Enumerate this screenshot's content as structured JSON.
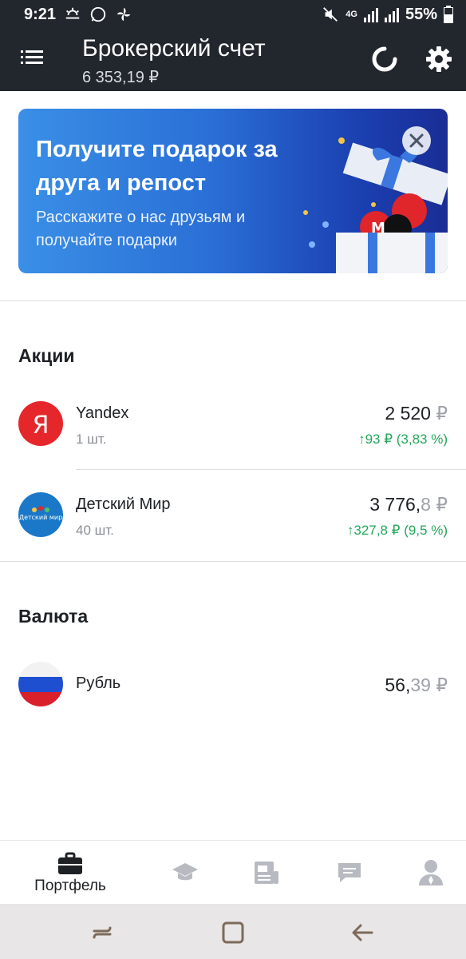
{
  "statusbar": {
    "time": "9:21",
    "network": "4G",
    "battery_pct": "55%"
  },
  "header": {
    "title": "Брокерский счет",
    "balance": "6 353,19 ₽"
  },
  "banner": {
    "title": "Получите подарок за друга и репост",
    "text": "Расскажите о нас друзьям и получайте подарки"
  },
  "stocks": {
    "section_title": "Акции",
    "items": [
      {
        "name": "Yandex",
        "qty": "1 шт.",
        "price_main": "2 520",
        "price_frac": "",
        "currency": "₽",
        "change": "↑93 ₽ (3,83 %)"
      },
      {
        "name": "Детский Мир",
        "qty": "40 шт.",
        "price_main": "3 776,",
        "price_frac": "8",
        "currency": "₽",
        "change": "↑327,8 ₽ (9,5 %)",
        "logo_text": "Детский мир"
      }
    ]
  },
  "currency": {
    "section_title": "Валюта",
    "items": [
      {
        "name": "Рубль",
        "price_main": "56,",
        "price_frac": "39",
        "currency": "₽"
      }
    ]
  },
  "bottom_nav": {
    "items": [
      {
        "label": "Портфель",
        "icon": "briefcase-icon",
        "active": true
      },
      {
        "label": "",
        "icon": "education-icon",
        "active": false
      },
      {
        "label": "",
        "icon": "news-icon",
        "active": false
      },
      {
        "label": "",
        "icon": "chat-icon",
        "active": false
      },
      {
        "label": "",
        "icon": "profile-icon",
        "active": false
      }
    ]
  },
  "colors": {
    "header_bg": "#22262d",
    "positive": "#23a85a",
    "banner_start": "#3a8fe6",
    "banner_end": "#1a2d95"
  }
}
